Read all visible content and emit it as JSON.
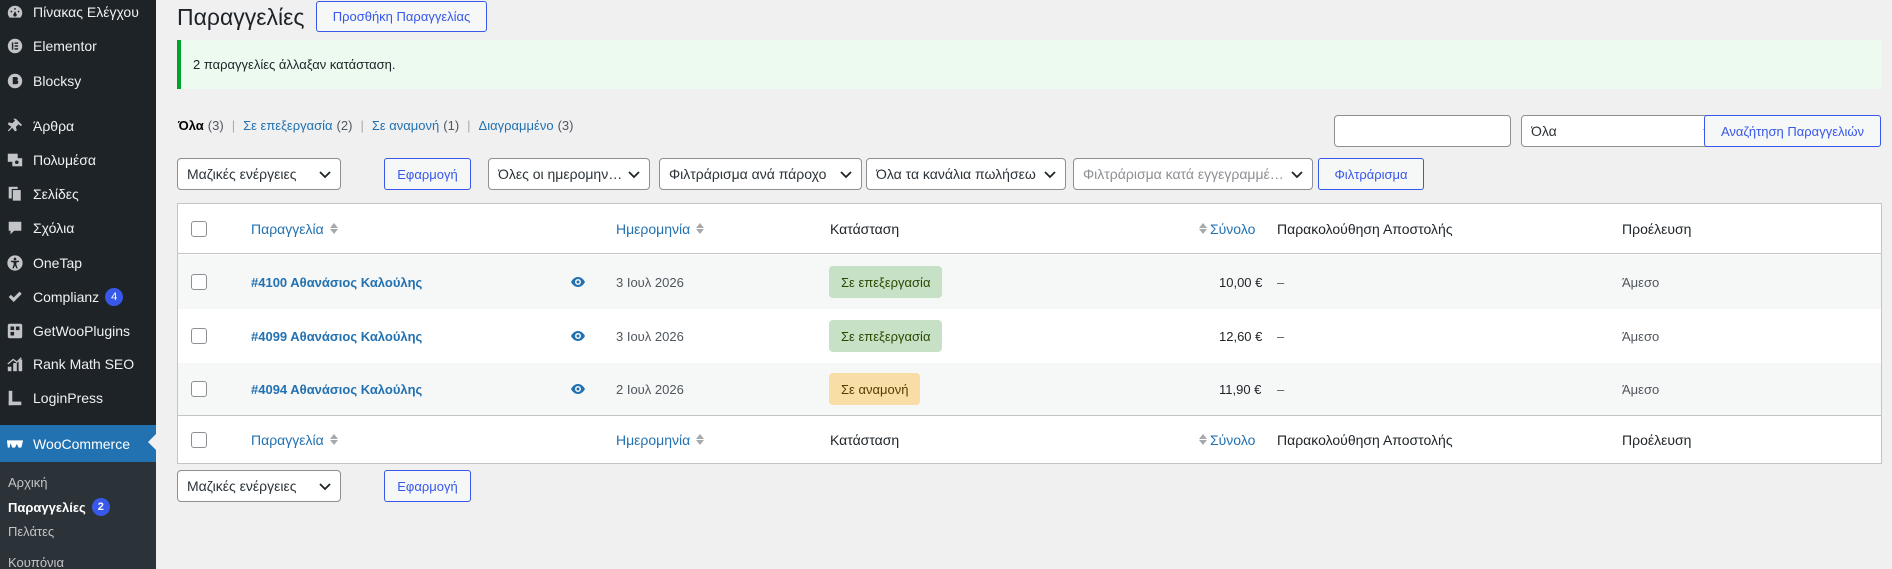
{
  "sidebar": {
    "items": [
      {
        "label": "Πίνακας Ελέγχου",
        "icon": "dashboard-icon"
      },
      {
        "label": "Elementor",
        "icon": "elementor-icon"
      },
      {
        "label": "Blocksy",
        "icon": "blocksy-icon"
      },
      {
        "label": "Άρθρα",
        "icon": "pin-icon"
      },
      {
        "label": "Πολυμέσα",
        "icon": "media-icon"
      },
      {
        "label": "Σελίδες",
        "icon": "pages-icon"
      },
      {
        "label": "Σχόλια",
        "icon": "comments-icon"
      },
      {
        "label": "OneTap",
        "icon": "accessibility-icon"
      },
      {
        "label": "Complianz",
        "icon": "check-icon",
        "badge": "4"
      },
      {
        "label": "GetWooPlugins",
        "icon": "plugins-icon"
      },
      {
        "label": "Rank Math SEO",
        "icon": "chart-icon"
      },
      {
        "label": "LoginPress",
        "icon": "login-icon"
      },
      {
        "label": "WooCommerce",
        "icon": "woo-icon"
      }
    ],
    "submenu": [
      {
        "label": "Αρχική"
      },
      {
        "label": "Παραγγελίες",
        "badge": "2"
      },
      {
        "label": "Πελάτες"
      },
      {
        "label": "Κουπόνια"
      }
    ]
  },
  "header": {
    "title": "Παραγγελίες",
    "add_button": "Προσθήκη Παραγγελίας"
  },
  "notice": {
    "text": "2 παραγγελίες άλλαξαν κατάσταση."
  },
  "views": [
    {
      "label": "Όλα",
      "count": "(3)"
    },
    {
      "label": "Σε επεξεργασία",
      "count": "(2)"
    },
    {
      "label": "Σε αναμονή",
      "count": "(1)"
    },
    {
      "label": "Διαγραμμένο",
      "count": "(3)"
    }
  ],
  "search": {
    "input_value": "",
    "scope": "Όλα",
    "button": "Αναζήτηση Παραγγελιών"
  },
  "filters": {
    "bulk_actions": "Μαζικές ενέργειες",
    "apply": "Εφαρμογή",
    "dates": "Όλες οι ημερομηνίες",
    "provider": "Φιλτράρισμα ανά πάροχο",
    "channels": "Όλα τα κανάλια πωλήσεω",
    "customer_placeholder": "Φιλτράρισμα κατά εγγεγραμμέν...",
    "filter_button": "Φιλτράρισμα"
  },
  "table": {
    "headers": {
      "order": "Παραγγελία",
      "date": "Ημερομηνία",
      "status": "Κατάσταση",
      "total": "Σύνολο",
      "tracking": "Παρακολούθηση Αποστολής",
      "origin": "Προέλευση"
    },
    "rows": [
      {
        "order": "#4100 Αθανάσιος Καλούλης",
        "date": "3 Ιουλ 2026",
        "status": "Σε επεξεργασία",
        "total": "10,00 €",
        "tracking": "–",
        "origin": "Άμεσο"
      },
      {
        "order": "#4099 Αθανάσιος Καλούλης",
        "date": "3 Ιουλ 2026",
        "status": "Σε επεξεργασία",
        "total": "12,60 €",
        "tracking": "–",
        "origin": "Άμεσο"
      },
      {
        "order": "#4094 Αθανάσιος Καλούλης",
        "date": "2 Ιουλ 2026",
        "status": "Σε αναμονή",
        "total": "11,90 €",
        "tracking": "–",
        "origin": "Άμεσο"
      }
    ]
  },
  "bottom": {
    "bulk_actions": "Μαζικές ενέργειες",
    "apply": "Εφαρμογή"
  },
  "colors": {
    "accent": "#3858e9",
    "link": "#2271b1",
    "sidebar": "#1d2327",
    "processing": "#c6e1c6",
    "onhold": "#f8dda7"
  }
}
